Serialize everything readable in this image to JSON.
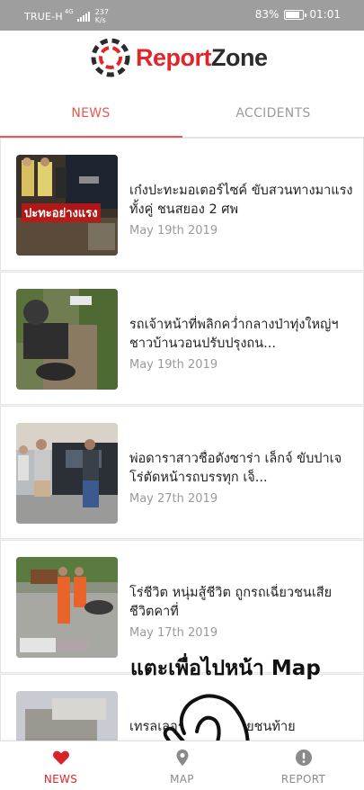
{
  "status_bar": {
    "carrier": "TRUE-H",
    "network": "4G",
    "speed_value": "237",
    "speed_unit": "K/s",
    "battery": "83%",
    "battery_level": 0.83,
    "time": "01:01"
  },
  "header": {
    "logo_report": "Report",
    "logo_zone": "Zone",
    "brand_color": "#e0262a"
  },
  "tabs": [
    {
      "label": "NEWS",
      "active": true
    },
    {
      "label": "ACCIDENTS",
      "active": false
    }
  ],
  "news": [
    {
      "title": "เก๋งปะทะมอเตอร์ไซค์ ขับสวนทางมาแรงทั้งคู่ ชนสยอง 2 ศพ",
      "date": "May 19th 2019",
      "image_caption": "ปะทะอย่างแรง"
    },
    {
      "title": "รถเจ้าหน้าที่พลิกคว่ำกลางป่าทุ่งใหญ่ฯ ชาวบ้านวอนปรับปรุงถน...",
      "date": "May 19th 2019"
    },
    {
      "title": "พ่อดาราสาวชื่อดังซาร่า เล็กจ์ ขับปาเจโร่ตัดหน้ารถบรรทุก เจ็...",
      "date": "May 27th 2019"
    },
    {
      "title": "โร่ชีวิต หนุ่มสู้ชีวิต ถูกรถเฉี่ยวชนเสียชีวิตคาที่",
      "date": "May 17th 2019"
    },
    {
      "title": "เทรลเลอร์บรรทุกทรายชนท้าย",
      "date": ""
    }
  ],
  "overlay": {
    "hint": "แตะเพื่อไปหน้า Map"
  },
  "bottom_nav": [
    {
      "label": "NEWS",
      "icon": "heart-icon",
      "active": true
    },
    {
      "label": "MAP",
      "icon": "map-icon",
      "active": false
    },
    {
      "label": "REPORT",
      "icon": "alert-icon",
      "active": false
    }
  ]
}
